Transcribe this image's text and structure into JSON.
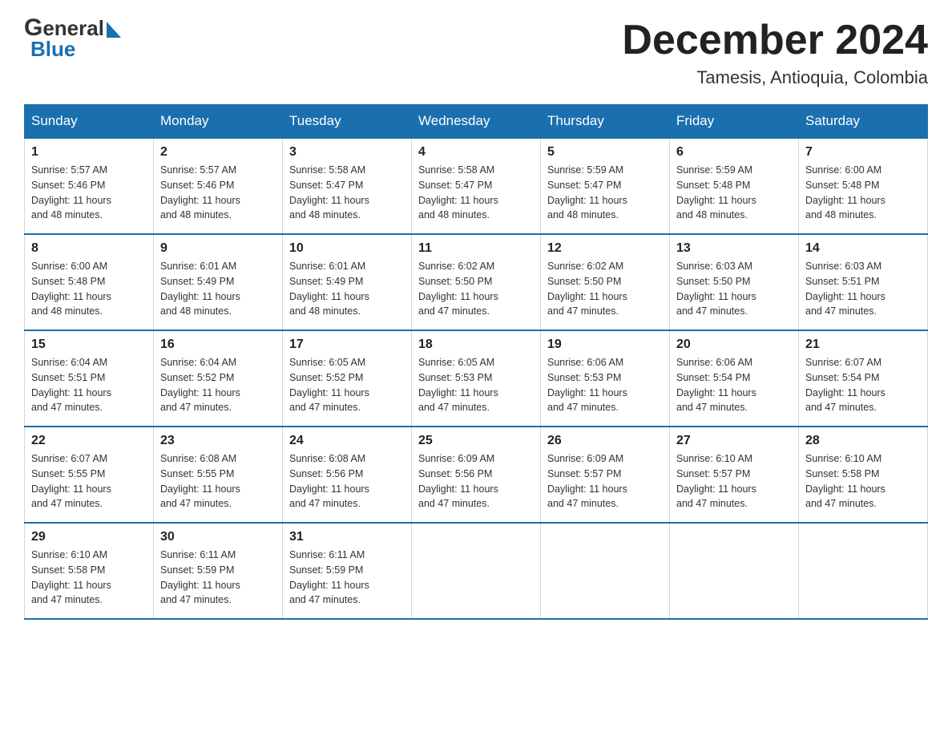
{
  "header": {
    "month_title": "December 2024",
    "location": "Tamesis, Antioquia, Colombia",
    "logo_general": "General",
    "logo_blue": "Blue"
  },
  "days_of_week": [
    "Sunday",
    "Monday",
    "Tuesday",
    "Wednesday",
    "Thursday",
    "Friday",
    "Saturday"
  ],
  "weeks": [
    [
      {
        "day": "1",
        "info": "Sunrise: 5:57 AM\nSunset: 5:46 PM\nDaylight: 11 hours\nand 48 minutes."
      },
      {
        "day": "2",
        "info": "Sunrise: 5:57 AM\nSunset: 5:46 PM\nDaylight: 11 hours\nand 48 minutes."
      },
      {
        "day": "3",
        "info": "Sunrise: 5:58 AM\nSunset: 5:47 PM\nDaylight: 11 hours\nand 48 minutes."
      },
      {
        "day": "4",
        "info": "Sunrise: 5:58 AM\nSunset: 5:47 PM\nDaylight: 11 hours\nand 48 minutes."
      },
      {
        "day": "5",
        "info": "Sunrise: 5:59 AM\nSunset: 5:47 PM\nDaylight: 11 hours\nand 48 minutes."
      },
      {
        "day": "6",
        "info": "Sunrise: 5:59 AM\nSunset: 5:48 PM\nDaylight: 11 hours\nand 48 minutes."
      },
      {
        "day": "7",
        "info": "Sunrise: 6:00 AM\nSunset: 5:48 PM\nDaylight: 11 hours\nand 48 minutes."
      }
    ],
    [
      {
        "day": "8",
        "info": "Sunrise: 6:00 AM\nSunset: 5:48 PM\nDaylight: 11 hours\nand 48 minutes."
      },
      {
        "day": "9",
        "info": "Sunrise: 6:01 AM\nSunset: 5:49 PM\nDaylight: 11 hours\nand 48 minutes."
      },
      {
        "day": "10",
        "info": "Sunrise: 6:01 AM\nSunset: 5:49 PM\nDaylight: 11 hours\nand 48 minutes."
      },
      {
        "day": "11",
        "info": "Sunrise: 6:02 AM\nSunset: 5:50 PM\nDaylight: 11 hours\nand 47 minutes."
      },
      {
        "day": "12",
        "info": "Sunrise: 6:02 AM\nSunset: 5:50 PM\nDaylight: 11 hours\nand 47 minutes."
      },
      {
        "day": "13",
        "info": "Sunrise: 6:03 AM\nSunset: 5:50 PM\nDaylight: 11 hours\nand 47 minutes."
      },
      {
        "day": "14",
        "info": "Sunrise: 6:03 AM\nSunset: 5:51 PM\nDaylight: 11 hours\nand 47 minutes."
      }
    ],
    [
      {
        "day": "15",
        "info": "Sunrise: 6:04 AM\nSunset: 5:51 PM\nDaylight: 11 hours\nand 47 minutes."
      },
      {
        "day": "16",
        "info": "Sunrise: 6:04 AM\nSunset: 5:52 PM\nDaylight: 11 hours\nand 47 minutes."
      },
      {
        "day": "17",
        "info": "Sunrise: 6:05 AM\nSunset: 5:52 PM\nDaylight: 11 hours\nand 47 minutes."
      },
      {
        "day": "18",
        "info": "Sunrise: 6:05 AM\nSunset: 5:53 PM\nDaylight: 11 hours\nand 47 minutes."
      },
      {
        "day": "19",
        "info": "Sunrise: 6:06 AM\nSunset: 5:53 PM\nDaylight: 11 hours\nand 47 minutes."
      },
      {
        "day": "20",
        "info": "Sunrise: 6:06 AM\nSunset: 5:54 PM\nDaylight: 11 hours\nand 47 minutes."
      },
      {
        "day": "21",
        "info": "Sunrise: 6:07 AM\nSunset: 5:54 PM\nDaylight: 11 hours\nand 47 minutes."
      }
    ],
    [
      {
        "day": "22",
        "info": "Sunrise: 6:07 AM\nSunset: 5:55 PM\nDaylight: 11 hours\nand 47 minutes."
      },
      {
        "day": "23",
        "info": "Sunrise: 6:08 AM\nSunset: 5:55 PM\nDaylight: 11 hours\nand 47 minutes."
      },
      {
        "day": "24",
        "info": "Sunrise: 6:08 AM\nSunset: 5:56 PM\nDaylight: 11 hours\nand 47 minutes."
      },
      {
        "day": "25",
        "info": "Sunrise: 6:09 AM\nSunset: 5:56 PM\nDaylight: 11 hours\nand 47 minutes."
      },
      {
        "day": "26",
        "info": "Sunrise: 6:09 AM\nSunset: 5:57 PM\nDaylight: 11 hours\nand 47 minutes."
      },
      {
        "day": "27",
        "info": "Sunrise: 6:10 AM\nSunset: 5:57 PM\nDaylight: 11 hours\nand 47 minutes."
      },
      {
        "day": "28",
        "info": "Sunrise: 6:10 AM\nSunset: 5:58 PM\nDaylight: 11 hours\nand 47 minutes."
      }
    ],
    [
      {
        "day": "29",
        "info": "Sunrise: 6:10 AM\nSunset: 5:58 PM\nDaylight: 11 hours\nand 47 minutes."
      },
      {
        "day": "30",
        "info": "Sunrise: 6:11 AM\nSunset: 5:59 PM\nDaylight: 11 hours\nand 47 minutes."
      },
      {
        "day": "31",
        "info": "Sunrise: 6:11 AM\nSunset: 5:59 PM\nDaylight: 11 hours\nand 47 minutes."
      },
      null,
      null,
      null,
      null
    ]
  ]
}
